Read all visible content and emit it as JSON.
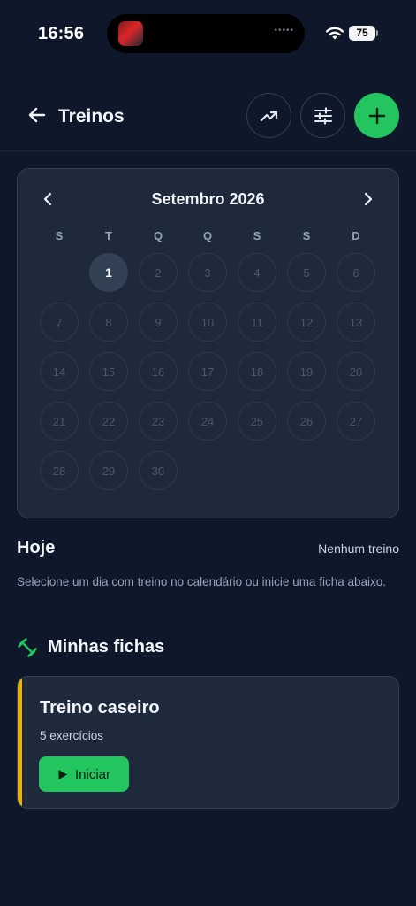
{
  "status_bar": {
    "time": "16:56",
    "battery": "75"
  },
  "header": {
    "title": "Treinos",
    "icons": {
      "back": "arrow-left-icon",
      "trend": "trending-up-icon",
      "filter": "sliders-icon",
      "add": "plus-icon"
    }
  },
  "calendar": {
    "month_label": "Setembro 2026",
    "weekdays": [
      "S",
      "T",
      "Q",
      "Q",
      "S",
      "S",
      "D"
    ],
    "first_weekday_index": 1,
    "days_in_month": 30,
    "selected_day": 1
  },
  "today": {
    "title": "Hoje",
    "status": "Nenhum treino",
    "description": "Selecione um dia com treino no calendário ou inicie uma ficha abaixo."
  },
  "fichas": {
    "title": "Minhas fichas",
    "items": [
      {
        "name": "Treino caseiro",
        "count": "5 exercícios",
        "start_label": "Iniciar",
        "accent": "#eab308"
      }
    ]
  },
  "colors": {
    "accent_green": "#22c55e",
    "background": "#0f172a",
    "card": "#1e293b"
  }
}
